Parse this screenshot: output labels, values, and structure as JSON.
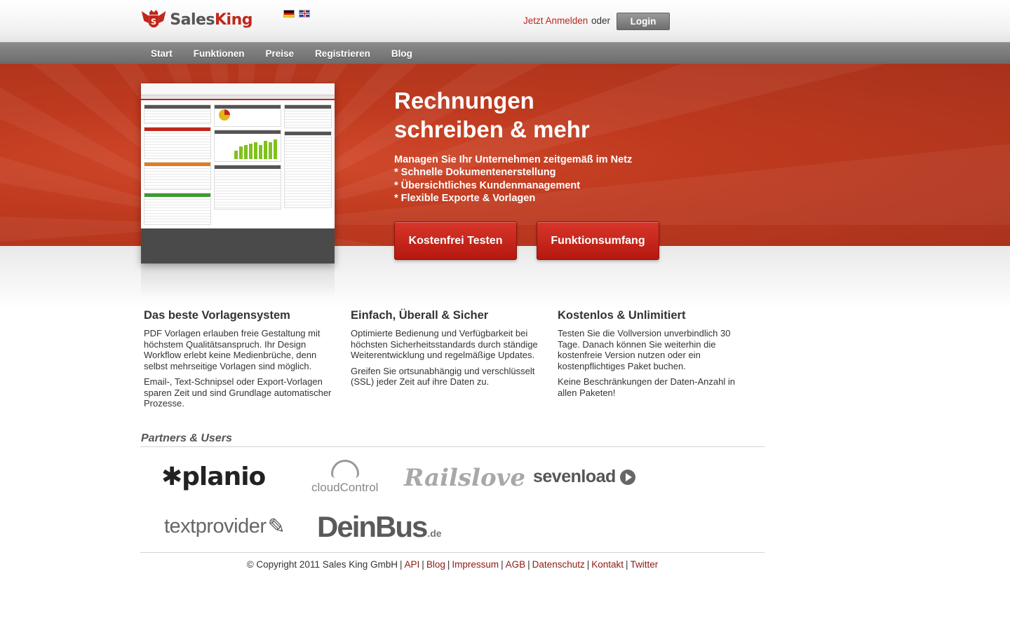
{
  "header": {
    "logo_word1": "Sales",
    "logo_word2": "King",
    "logo_badge": "S",
    "signup_link": "Jetzt Anmelden",
    "or_text": "oder",
    "login_label": "Login"
  },
  "nav": {
    "items": [
      {
        "label": "Start"
      },
      {
        "label": "Funktionen"
      },
      {
        "label": "Preise"
      },
      {
        "label": "Registrieren"
      },
      {
        "label": "Blog"
      }
    ]
  },
  "hero": {
    "title_line1": "Rechnungen",
    "title_line2": "schreiben & mehr",
    "tagline": "Managen Sie Ihr Unternehmen zeitgemäß im Netz",
    "features": [
      "* Schnelle Dokumentenerstellung",
      "* Übersichtliches Kundenmanagement",
      "* Flexible Exporte & Vorlagen"
    ],
    "btn_try": "Kostenfrei Testen",
    "btn_features": "Funktionsumfang"
  },
  "columns": [
    {
      "title": "Das beste Vorlagensystem",
      "p1": "PDF Vorlagen erlauben freie Gestaltung mit höchstem Qualitätsanspruch. Ihr Design Workflow erlebt keine Medienbrüche, denn selbst mehrseitige Vorlagen sind möglich.",
      "p2": "Email-, Text-Schnipsel oder Export-Vorlagen sparen Zeit und sind Grundlage automatischer Prozesse."
    },
    {
      "title": "Einfach, Überall & Sicher",
      "p1": "Optimierte Bedienung und Verfügbarkeit bei höchsten Sicherheitsstandards durch ständige Weiterentwicklung und regelmäßige Updates.",
      "p2": "Greifen Sie ortsunabhängig und verschlüsselt (SSL) jeder Zeit auf ihre Daten zu."
    },
    {
      "title": "Kostenlos & Unlimitiert",
      "p1": "Testen Sie die Vollversion unverbindlich 30 Tage. Danach können Sie weiterhin die kostenfreie Version nutzen oder ein kostenpflichtiges Paket buchen.",
      "p2": "Keine Beschränkungen der Daten-Anzahl in allen Paketen!"
    }
  ],
  "partners": {
    "title": "Partners & Users",
    "planio": "✱planio",
    "cloudcontrol": "cloudControl",
    "railslove": "Railslove",
    "sevenload": "sevenload",
    "textprovider": "textprovider",
    "deinbus": "DeinBus",
    "deinbus_tld": ".de"
  },
  "footer": {
    "copyright": "© Copyright 2011 Sales King GmbH",
    "links": [
      "API",
      "Blog",
      "Impressum",
      "AGB",
      "Datenschutz",
      "Kontakt",
      "Twitter"
    ]
  },
  "colors": {
    "brand_red": "#c0271b",
    "hero_red": "#bf3a1f",
    "nav_gray": "#7a7a7a",
    "link_dark_red": "#8f1a12"
  }
}
